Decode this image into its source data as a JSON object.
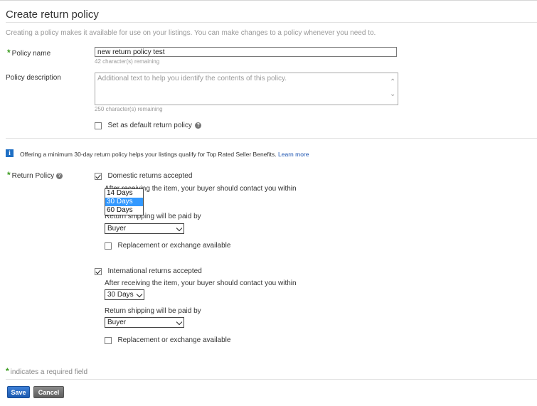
{
  "page": {
    "title": "Create return policy",
    "intro": "Creating a policy makes it available for use on your listings. You can make changes to a policy whenever you need to."
  },
  "policy_name": {
    "label": "Policy name",
    "value": "new return policy test",
    "hint": "42 character(s) remaining"
  },
  "policy_description": {
    "label": "Policy description",
    "placeholder": "Additional text to help you identify the contents of this policy.",
    "hint": "250 character(s) remaining"
  },
  "default_policy": {
    "label": "Set as default return policy",
    "checked": false
  },
  "info_banner": {
    "text": "Offering a minimum 30-day return policy helps your listings qualify for Top Rated Seller Benefits.",
    "link": "Learn more"
  },
  "return_policy": {
    "label": "Return Policy",
    "domestic": {
      "checkbox_label": "Domestic returns accepted",
      "checked": true,
      "contact_text": "After receiving the item, your buyer should contact you within",
      "contact_options": [
        "14 Days",
        "30 Days",
        "60 Days"
      ],
      "contact_selected": "30 Days",
      "shipping_text": "Return shipping will be paid by",
      "shipping_value": "Buyer",
      "replacement_label": "Replacement or exchange available",
      "replacement_checked": false
    },
    "international": {
      "checkbox_label": "International returns accepted",
      "checked": true,
      "contact_text": "After receiving the item, your buyer should contact you within",
      "contact_value": "30 Days",
      "shipping_text": "Return shipping will be paid by",
      "shipping_value": "Buyer",
      "replacement_label": "Replacement or exchange available",
      "replacement_checked": false
    }
  },
  "required_note": "indicates a required field",
  "buttons": {
    "save": "Save",
    "cancel": "Cancel"
  },
  "colors": {
    "required_star": "#3a9b1e",
    "save_button": "#1c5ab0",
    "cancel_button": "#5e5e5e",
    "info_icon": "#1f6fc4",
    "link": "#1b53b0",
    "selected_option": "#3399ff"
  }
}
